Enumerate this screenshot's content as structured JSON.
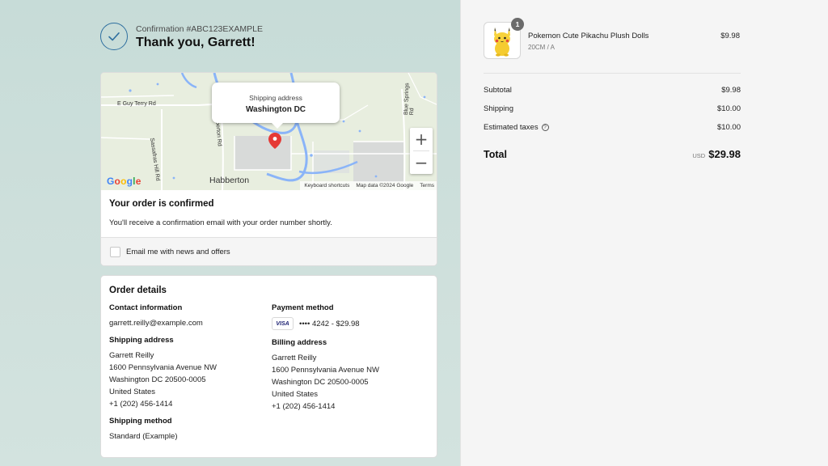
{
  "header": {
    "confirmation": "Confirmation #ABC123EXAMPLE",
    "thanks": "Thank you, Garrett!"
  },
  "map": {
    "bubble_label": "Shipping address",
    "bubble_value": "Washington DC",
    "zoom_in": "+",
    "zoom_out": "−",
    "town_label": "Habberton",
    "road_labels": [
      "E Guy Terry Rd",
      "Sassafras Hill Rd",
      "Habberton Rd",
      "Blue Springs Rd"
    ],
    "footer": [
      "Keyboard shortcuts",
      "Map data ©2024 Google",
      "Terms"
    ],
    "logo": "Google"
  },
  "confirmation": {
    "title": "Your order is confirmed",
    "text": "You'll receive a confirmation email with your order number shortly.",
    "email_opt_in": "Email me with news and offers"
  },
  "order_details": {
    "title": "Order details",
    "contact": {
      "heading": "Contact information",
      "email": "garrett.reilly@example.com"
    },
    "payment": {
      "heading": "Payment method",
      "brand": "VISA",
      "card": "•••• 4242 - $29.98"
    },
    "shipping_address": {
      "heading": "Shipping address",
      "lines": [
        "Garrett Reilly",
        "1600 Pennsylvania Avenue NW",
        "Washington DC 20500-0005",
        "United States",
        "+1 (202) 456-1414"
      ]
    },
    "billing_address": {
      "heading": "Billing address",
      "lines": [
        "Garrett Reilly",
        "1600 Pennsylvania Avenue NW",
        "Washington DC 20500-0005",
        "United States",
        "+1 (202) 456-1414"
      ]
    },
    "shipping_method": {
      "heading": "Shipping method",
      "value": "Standard (Example)"
    }
  },
  "summary": {
    "product": {
      "name": "Pokemon Cute Pikachu Plush Dolls",
      "variant": "20CM / A",
      "price": "$9.98",
      "quantity": "1"
    },
    "subtotal": {
      "label": "Subtotal",
      "value": "$9.98"
    },
    "shipping": {
      "label": "Shipping",
      "value": "$10.00"
    },
    "taxes": {
      "label": "Estimated taxes",
      "value": "$10.00"
    },
    "total": {
      "label": "Total",
      "currency": "USD",
      "value": "$29.98"
    }
  },
  "colors": {
    "left_bg": "#c9ddd9",
    "right_bg": "#f5f5f5",
    "accent": "#2f6f9f",
    "pin": "#e53935"
  }
}
